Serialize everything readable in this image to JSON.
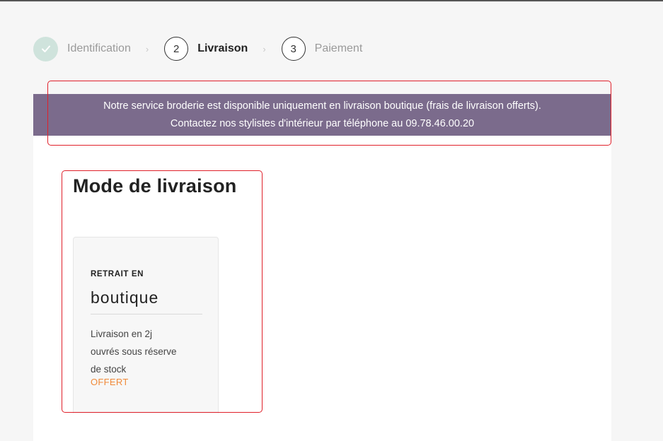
{
  "stepper": {
    "steps": [
      {
        "label": "Identification",
        "state": "done",
        "icon": "check-icon"
      },
      {
        "number": "2",
        "label": "Livraison",
        "state": "active"
      },
      {
        "number": "3",
        "label": "Paiement",
        "state": "upcoming"
      }
    ],
    "separator": "›"
  },
  "banner": {
    "line1": "Notre service broderie est disponible uniquement en livraison boutique (frais de livraison offerts).",
    "line2": "Contactez nos stylistes d'intérieur par téléphone au 09.78.46.00.20"
  },
  "delivery": {
    "title": "Mode de livraison",
    "options": [
      {
        "eyebrow": "RETRAIT EN",
        "name": "boutique",
        "description": "Livraison en 2j ouvrés sous réserve de stock",
        "price": "OFFERT"
      }
    ]
  },
  "colors": {
    "banner_bg": "#7b6b8c",
    "done_step": "#cfe3dc",
    "price": "#f08a3a",
    "highlight": "#e0202a"
  }
}
